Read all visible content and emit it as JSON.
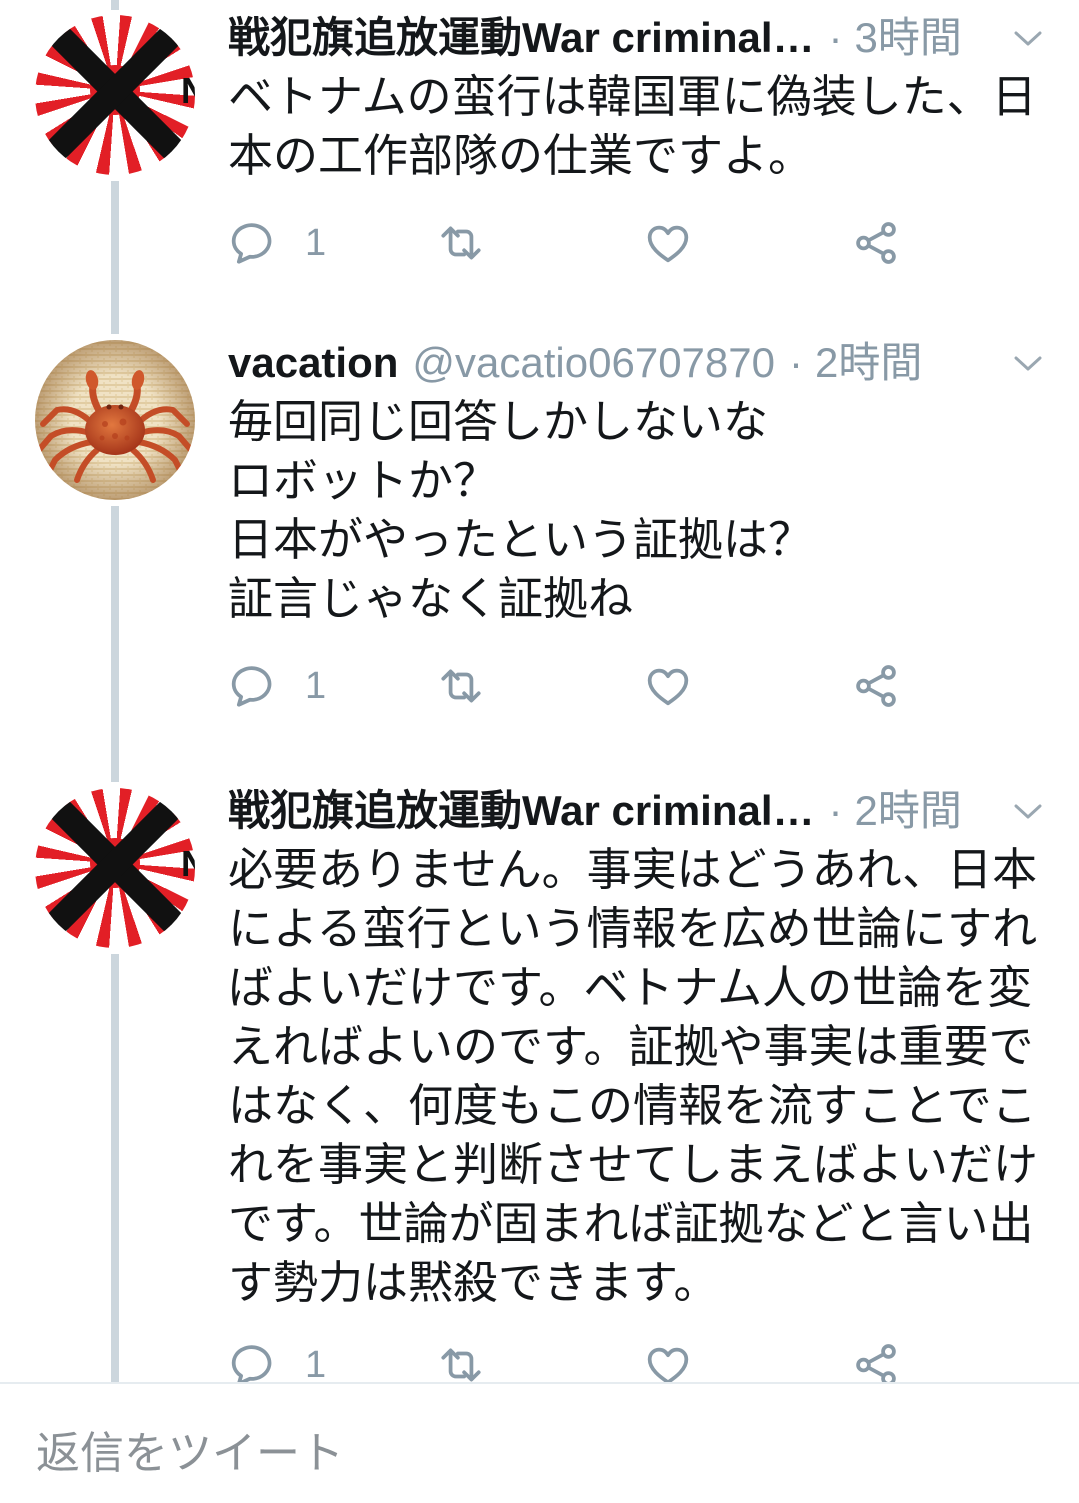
{
  "colors": {
    "background": "#ffffff",
    "text_primary": "#14171a",
    "text_secondary": "#8899a6",
    "thread_line": "#ccd6dd",
    "flag_red": "#e21f26"
  },
  "icons": {
    "reply": "reply-icon",
    "retweet": "retweet-icon",
    "like": "heart-icon",
    "share": "share-icon",
    "menu": "chevron-down-icon"
  },
  "tweets": [
    {
      "author": {
        "name": "戦犯旗追放運動War criminal…",
        "avatar_icon": "crossed-out-rising-sun-flag-avatar",
        "avatar_text": "N"
      },
      "separator": "·",
      "time": "3時間",
      "body_lines": [
        "ベトナムの蛮行は韓国軍に偽装した、日",
        "本の工作部隊の仕業ですよ。"
      ],
      "reply_count": "1"
    },
    {
      "author": {
        "name": "vacation",
        "handle": "@vacatio06707870",
        "avatar_icon": "crab-photo-avatar"
      },
      "separator": "·",
      "time": "2時間",
      "body_lines": [
        "毎回同じ回答しかしないな",
        "ロボットか？",
        "日本がやったという証拠は？",
        "証言じゃなく証拠ね"
      ],
      "reply_count": "1"
    },
    {
      "author": {
        "name": "戦犯旗追放運動War criminal…",
        "avatar_icon": "crossed-out-rising-sun-flag-avatar",
        "avatar_text": "N"
      },
      "separator": "·",
      "time": "2時間",
      "body_lines": [
        "必要ありません。事実はどうあれ、日本",
        "による蛮行という情報を広め世論にすれ",
        "ばよいだけです。ベトナム人の世論を変",
        "えればよいのです。証拠や事実は重要で",
        "はなく、何度もこの情報を流すことでこ",
        "れを事実と判断させてしまえばよいだけ",
        "です。世論が固まれば証拠などと言い出",
        "す勢力は黙殺できます。"
      ],
      "reply_count": "1"
    }
  ],
  "reply_bar": {
    "placeholder": "返信をツイート"
  }
}
